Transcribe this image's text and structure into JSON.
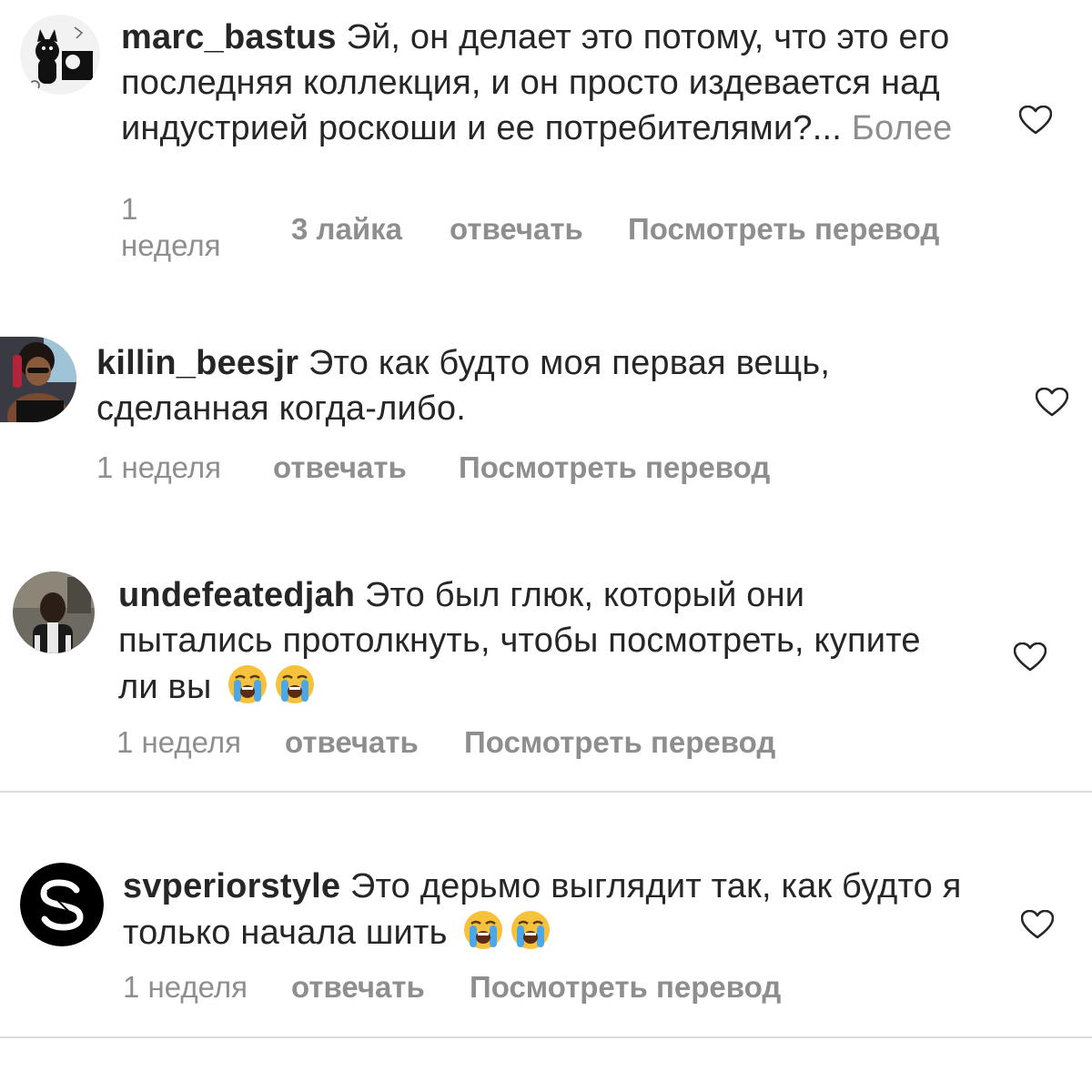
{
  "comments": [
    {
      "username": "marc_bastus",
      "text": "Эй, он делает это потому, что это его последняя коллекция, и он просто издевается над индустрией роскоши и ее потребителями?...",
      "more_label": "Более",
      "time_line1": "1",
      "time_line2": "неделя",
      "likes": "3 лайка",
      "reply_label": "отвечать",
      "translate_label": "Посмотреть перевод",
      "like_icon": "heart-outline-icon"
    },
    {
      "username": "killin_beesjr",
      "text": "Это как будто моя первая вещь, сделанная когда-либо.",
      "time": "1 неделя",
      "reply_label": "отвечать",
      "translate_label": "Посмотреть перевод",
      "like_icon": "heart-outline-icon"
    },
    {
      "username": "undefeatedjah",
      "text": "Это был глюк, который они пытались протолкнуть, чтобы посмотреть, купите ли вы",
      "emojis": [
        "loudly-crying-face",
        "loudly-crying-face"
      ],
      "time": "1 неделя",
      "reply_label": "отвечать",
      "translate_label": "Посмотреть перевод",
      "like_icon": "heart-outline-icon"
    },
    {
      "username": "svperiorstyle",
      "text": "Это дерьмо выглядит так, как будто я только начала шить",
      "emojis": [
        "loudly-crying-face",
        "loudly-crying-face"
      ],
      "time": "1 неделя",
      "reply_label": "отвечать",
      "translate_label": "Посмотреть перевод",
      "like_icon": "heart-outline-icon"
    }
  ],
  "colors": {
    "text": "#262626",
    "secondary": "#8e8e8e",
    "divider": "#dbdbdb",
    "emoji_face": "#f7c23b",
    "emoji_tears": "#4aa8e8"
  }
}
